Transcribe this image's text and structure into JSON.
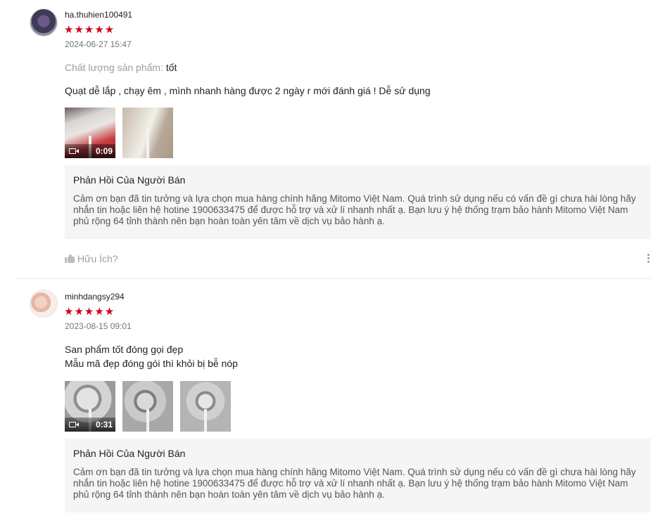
{
  "reviews": [
    {
      "username": "ha.thuhien100491",
      "stars": "★★★★★",
      "rating": 5,
      "date": "2024-06-27 15:47",
      "quality_label": "Chất lượng sản phẩm: ",
      "quality_value": "tốt",
      "content_lines": [
        "Quạt dễ lắp , chạy êm , mình nhanh hàng được 2 ngày r mới đánh giá ! Dễ sử dụng"
      ],
      "media": [
        {
          "type": "video",
          "duration": "0:09",
          "icon": "video-camera-icon"
        },
        {
          "type": "image"
        }
      ],
      "reply": {
        "title": "Phản Hồi Của Người Bán",
        "text": "Cảm ơn bạn đã tin tưởng và lựa chọn mua hàng chính hãng Mitomo Việt Nam. Quá trình sử dụng nếu có vấn đề gì chưa hài lòng hãy nhắn tin hoặc liên hệ hotine 1900633475 để được hỗ trợ và xử lí nhanh nhất ạ. Bạn lưu ý hệ thống trạm bảo hành Mitomo Việt Nam phủ rộng 64 tỉnh thành nên bạn hoàn toàn yên tâm về dịch vụ bảo hành ạ."
      },
      "helpful_label": "Hữu Ích?"
    },
    {
      "username": "minhdangsy294",
      "stars": "★★★★★",
      "rating": 5,
      "date": "2023-08-15 09:01",
      "content_lines": [
        "San phẩm tốt đóng gọi đẹp",
        "Mẫu mã đẹp đóng gói thì khỏi bị bễ nóp"
      ],
      "media": [
        {
          "type": "video",
          "duration": "0:31",
          "icon": "video-camera-icon"
        },
        {
          "type": "image"
        },
        {
          "type": "image"
        }
      ],
      "reply": {
        "title": "Phản Hồi Của Người Bán",
        "text": "Cảm ơn bạn đã tin tưởng và lựa chọn mua hàng chính hãng Mitomo Việt Nam. Quá trình sử dụng nếu có vấn đề gì chưa hài lòng hãy nhắn tin hoặc liên hệ hotine 1900633475 để được hỗ trợ và xử lí nhanh nhất ạ. Bạn lưu ý hệ thống trạm bảo hành Mitomo Việt Nam phủ rộng 64 tỉnh thành nên bạn hoàn toàn yên tâm về dịch vụ bảo hành ạ."
      }
    }
  ],
  "colors": {
    "star": "#d0011b",
    "reply_bg": "#f5f5f5",
    "muted": "#9e9e9e"
  }
}
